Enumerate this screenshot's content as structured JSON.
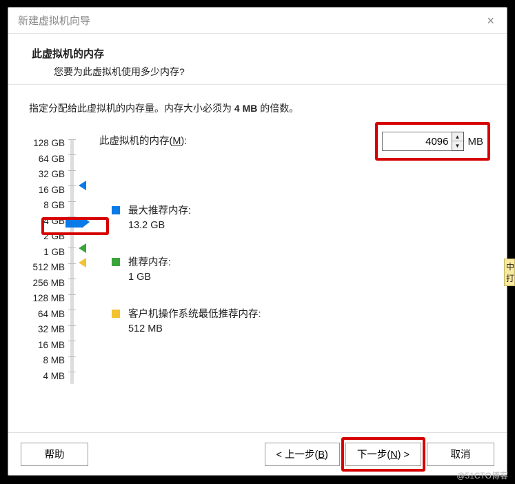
{
  "titlebar": {
    "title": "新建虚拟机向导",
    "close": "×"
  },
  "header": {
    "title": "此虚拟机的内存",
    "subtitle": "您要为此虚拟机使用多少内存?"
  },
  "instruction": {
    "pre": "指定分配给此虚拟机的内存量。内存大小必须为 ",
    "bold": "4 MB",
    "post": " 的倍数。"
  },
  "ticks": [
    "128 GB",
    "64 GB",
    "32 GB",
    "16 GB",
    "8 GB",
    "4 GB",
    "2 GB",
    "1 GB",
    "512 MB",
    "256 MB",
    "128 MB",
    "64 MB",
    "32 MB",
    "16 MB",
    "8 MB",
    "4 MB"
  ],
  "memory": {
    "label_pre": "此虚拟机的内存(",
    "label_key": "M",
    "label_post": "):",
    "value": "4096",
    "unit": "MB"
  },
  "legend": {
    "max": {
      "title": "最大推荐内存:",
      "value": "13.2 GB",
      "color": "#0a7ae6"
    },
    "rec": {
      "title": "推荐内存:",
      "value": "1 GB",
      "color": "#3aa53a"
    },
    "min": {
      "title": "客户机操作系统最低推荐内存:",
      "value": "512 MB",
      "color": "#f2c230"
    }
  },
  "markers": {
    "max_color": "#0a7ae6",
    "rec_color": "#3aa53a",
    "min_color": "#f2c230"
  },
  "footer": {
    "help": "帮助",
    "back": "< 上一步(B)",
    "next": "下一步(N) >",
    "cancel": "取消"
  },
  "callout": "中打",
  "watermark": "@51CTO博客"
}
